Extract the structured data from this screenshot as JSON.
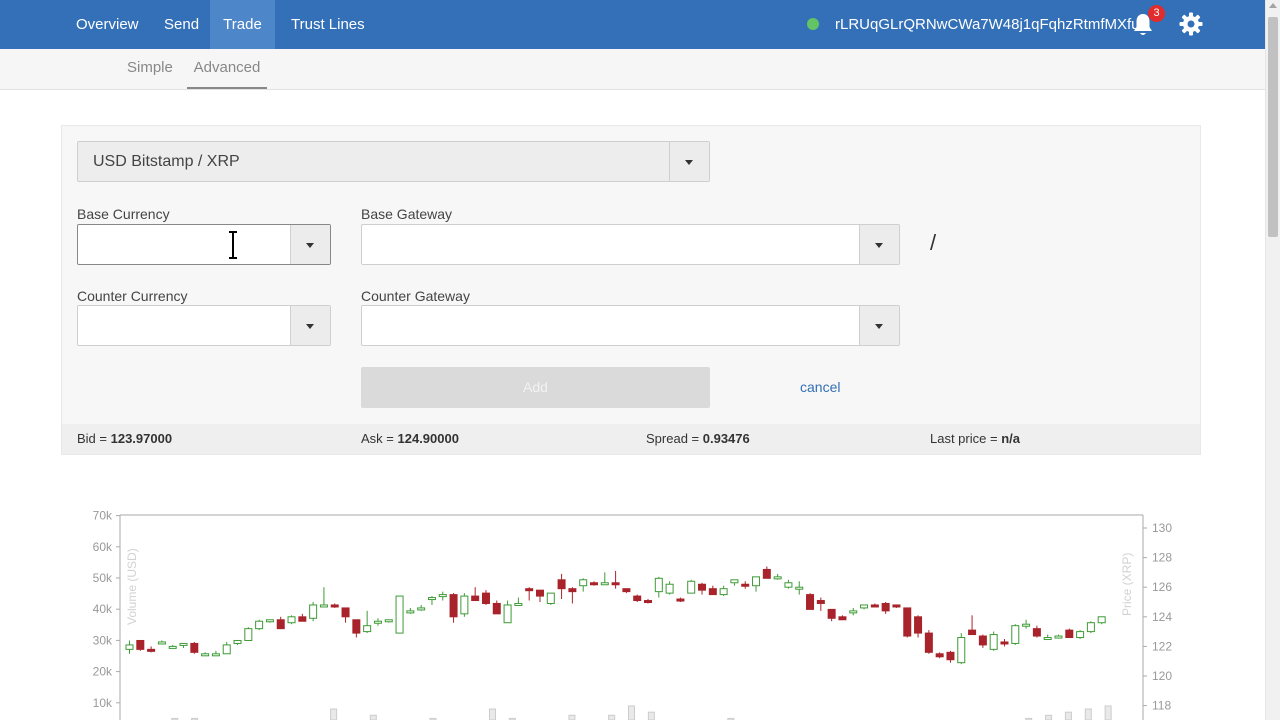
{
  "topbar": {
    "nav": [
      "Overview",
      "Send",
      "Trade",
      "Trust Lines"
    ],
    "active": "Trade",
    "address": "rLRUqGLrQRNwCWa7W48j1qFqhzRtmfMXfu",
    "notification_count": "3",
    "status_color": "#63c466",
    "accent_color": "#3370b7"
  },
  "subnav": {
    "items": [
      "Simple",
      "Advanced"
    ],
    "active": "Advanced"
  },
  "form": {
    "pair_selected": "USD Bitstamp / XRP",
    "base_currency_label": "Base Currency",
    "base_currency_value": "",
    "base_gateway_label": "Base Gateway",
    "base_gateway_value": "",
    "separator": "/",
    "counter_currency_label": "Counter Currency",
    "counter_currency_value": "",
    "counter_gateway_label": "Counter Gateway",
    "counter_gateway_value": "",
    "add_label": "Add",
    "cancel_label": "cancel"
  },
  "quotes": {
    "bid_label": "Bid = ",
    "bid_value": "123.97000",
    "ask_label": "Ask = ",
    "ask_value": "124.90000",
    "spread_label": "Spread = ",
    "spread_value": "0.93476",
    "last_label": "Last price = ",
    "last_value": "n/a"
  },
  "chart_data": {
    "type": "candlestick",
    "left_axis_label": "Volume (USD)",
    "right_axis_label": "Price (XRP)",
    "left_ticks": [
      "10k",
      "20k",
      "30k",
      "40k",
      "50k",
      "60k",
      "70k"
    ],
    "right_ticks": [
      "118",
      "120",
      "122",
      "124",
      "126",
      "128",
      "130"
    ],
    "left_range": [
      0,
      70000
    ],
    "right_range": [
      116.8,
      130.8
    ],
    "up_color": "#3d9b35",
    "down_color": "#a8232b",
    "volume_color": "#cccccc",
    "candles": [
      [
        121.8,
        122.4,
        121.5,
        122.1
      ],
      [
        122.4,
        122.4,
        121.7,
        121.8
      ],
      [
        121.8,
        122.0,
        121.6,
        121.7
      ],
      [
        122.3,
        122.4,
        122.2,
        122.3
      ],
      [
        122.0,
        122.1,
        121.9,
        122.0
      ],
      [
        122.1,
        122.2,
        121.9,
        122.2
      ],
      [
        122.2,
        122.3,
        121.5,
        121.6
      ],
      [
        121.5,
        121.6,
        121.4,
        121.5
      ],
      [
        121.5,
        121.7,
        121.4,
        121.5
      ],
      [
        121.5,
        122.3,
        121.5,
        122.1
      ],
      [
        122.2,
        122.4,
        122.1,
        122.4
      ],
      [
        122.4,
        123.3,
        122.4,
        123.2
      ],
      [
        123.2,
        123.8,
        123.1,
        123.7
      ],
      [
        123.7,
        123.8,
        123.6,
        123.8
      ],
      [
        123.8,
        124.0,
        123.2,
        123.2
      ],
      [
        123.6,
        124.1,
        123.5,
        124.0
      ],
      [
        124.0,
        124.2,
        123.8,
        123.7
      ],
      [
        123.9,
        125.0,
        123.7,
        124.8
      ],
      [
        124.8,
        126.0,
        124.7,
        124.8
      ],
      [
        124.8,
        124.9,
        124.6,
        124.7
      ],
      [
        124.6,
        124.6,
        123.6,
        124.0
      ],
      [
        123.8,
        123.8,
        122.6,
        122.9
      ],
      [
        123.0,
        124.4,
        122.9,
        123.4
      ],
      [
        123.6,
        123.9,
        123.4,
        123.7
      ],
      [
        123.8,
        123.8,
        123.6,
        123.8
      ],
      [
        122.9,
        125.4,
        122.9,
        125.4
      ],
      [
        124.4,
        124.6,
        124.2,
        124.4
      ],
      [
        124.5,
        124.8,
        124.4,
        124.6
      ],
      [
        125.2,
        125.4,
        124.8,
        125.3
      ],
      [
        125.4,
        125.7,
        125.1,
        125.5
      ],
      [
        125.5,
        125.6,
        123.6,
        124.0
      ],
      [
        124.2,
        125.6,
        124.0,
        125.4
      ],
      [
        125.4,
        126.0,
        125.1,
        125.1
      ],
      [
        125.6,
        125.8,
        124.8,
        124.9
      ],
      [
        124.9,
        125.1,
        124.5,
        124.2
      ],
      [
        123.6,
        125.1,
        123.6,
        124.8
      ],
      [
        124.9,
        125.3,
        124.8,
        124.9
      ],
      [
        125.9,
        126.0,
        125.1,
        125.8
      ],
      [
        125.8,
        125.8,
        125.0,
        125.4
      ],
      [
        124.9,
        125.6,
        124.8,
        125.6
      ],
      [
        126.5,
        126.9,
        125.2,
        125.9
      ],
      [
        125.9,
        126.0,
        124.9,
        125.7
      ],
      [
        126.1,
        126.6,
        125.7,
        126.5
      ],
      [
        126.3,
        126.4,
        126.1,
        126.2
      ],
      [
        126.3,
        127.0,
        126.2,
        126.3
      ],
      [
        126.3,
        127.1,
        125.9,
        126.2
      ],
      [
        125.9,
        125.9,
        125.6,
        125.7
      ],
      [
        125.4,
        125.5,
        125.0,
        125.1
      ],
      [
        125.1,
        125.2,
        124.9,
        125.0
      ],
      [
        125.7,
        126.7,
        125.3,
        126.6
      ],
      [
        125.6,
        126.4,
        125.5,
        126.2
      ],
      [
        125.2,
        125.3,
        125.0,
        125.1
      ],
      [
        125.6,
        126.5,
        125.6,
        126.4
      ],
      [
        126.2,
        126.3,
        125.5,
        125.8
      ],
      [
        125.9,
        126.1,
        125.5,
        125.5
      ],
      [
        125.5,
        126.1,
        125.4,
        125.9
      ],
      [
        126.3,
        126.5,
        126.1,
        126.5
      ],
      [
        126.2,
        126.4,
        125.9,
        126.1
      ],
      [
        126.1,
        126.7,
        125.7,
        126.7
      ],
      [
        127.2,
        127.4,
        126.6,
        126.6
      ],
      [
        126.7,
        126.9,
        126.5,
        126.7
      ],
      [
        126.0,
        126.5,
        125.9,
        126.3
      ],
      [
        126.0,
        126.4,
        125.5,
        126.0
      ],
      [
        125.5,
        125.6,
        124.7,
        124.5
      ],
      [
        125.1,
        125.3,
        124.4,
        124.9
      ],
      [
        124.5,
        124.5,
        123.7,
        123.9
      ],
      [
        124.0,
        124.1,
        123.8,
        123.8
      ],
      [
        124.3,
        124.6,
        124.1,
        124.4
      ],
      [
        124.6,
        124.8,
        124.5,
        124.8
      ],
      [
        124.8,
        124.9,
        124.7,
        124.7
      ],
      [
        124.9,
        125.0,
        124.2,
        124.4
      ],
      [
        124.8,
        124.8,
        124.6,
        124.7
      ],
      [
        124.6,
        124.6,
        122.6,
        122.7
      ],
      [
        124.0,
        124.1,
        122.6,
        122.9
      ],
      [
        122.9,
        123.1,
        121.5,
        121.6
      ],
      [
        121.5,
        121.6,
        121.2,
        121.3
      ],
      [
        121.6,
        121.7,
        120.9,
        121.1
      ],
      [
        120.9,
        122.9,
        120.8,
        122.6
      ],
      [
        123.1,
        124.1,
        123.0,
        122.8
      ],
      [
        122.7,
        122.8,
        121.9,
        122.1
      ],
      [
        121.8,
        123.0,
        121.7,
        122.8
      ],
      [
        122.3,
        122.5,
        122.0,
        122.2
      ],
      [
        122.2,
        123.5,
        122.1,
        123.4
      ],
      [
        123.4,
        123.8,
        123.2,
        123.5
      ],
      [
        123.2,
        123.4,
        122.6,
        122.7
      ],
      [
        122.6,
        122.8,
        122.5,
        122.6
      ],
      [
        122.7,
        122.8,
        122.6,
        122.7
      ],
      [
        123.1,
        123.2,
        122.6,
        122.6
      ],
      [
        122.6,
        123.1,
        122.5,
        123.0
      ],
      [
        123.0,
        123.7,
        122.9,
        123.6
      ],
      [
        123.6,
        124.0,
        123.5,
        124.0
      ]
    ],
    "volumes": [
      3000,
      2000,
      5000,
      5000,
      2000,
      1000,
      3000,
      2000,
      4000,
      1000,
      8000,
      2000,
      6000,
      3000,
      2000,
      5000,
      2000,
      3000,
      8000,
      5000,
      4000,
      4000,
      6000,
      3000,
      6000,
      9000,
      7000,
      2000,
      1000,
      1000,
      5000,
      3000,
      2000,
      2000,
      3000,
      1000,
      4000,
      2000,
      1000,
      4000,
      2000,
      2000,
      3000,
      4000,
      1000,
      5000,
      6000,
      7000,
      8000,
      9000
    ]
  }
}
